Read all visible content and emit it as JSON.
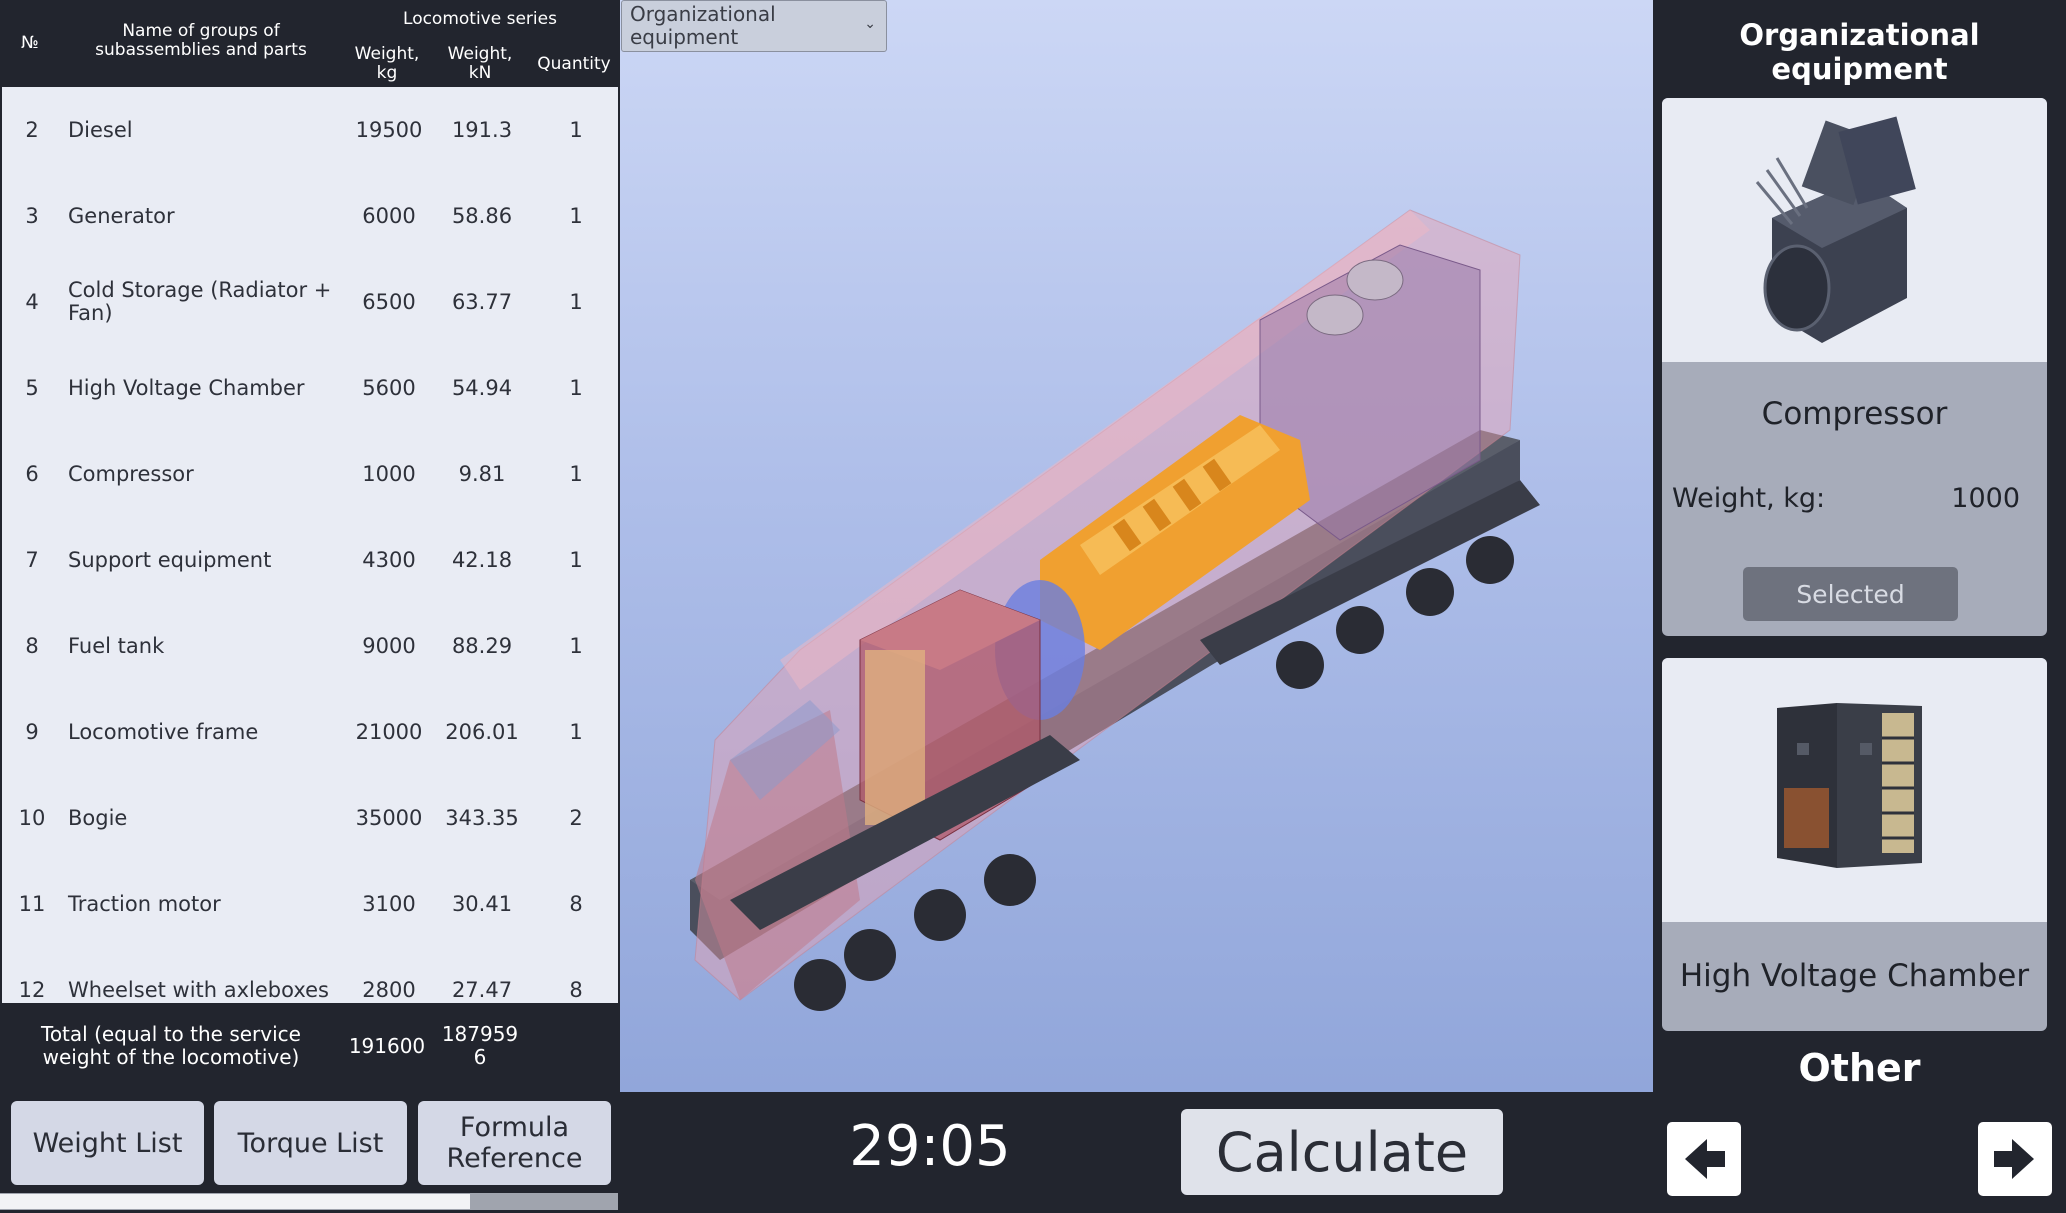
{
  "table": {
    "header": {
      "num": "№",
      "name": "Name of groups of subassemblies and parts",
      "series": "Locomotive series",
      "weight_kg": "Weight, kg",
      "weight_kn": "Weight, kN",
      "quantity": "Quantity"
    },
    "rows": [
      {
        "num": "2",
        "name": "Diesel",
        "kg": "19500",
        "kn": "191.3",
        "qty": "1"
      },
      {
        "num": "3",
        "name": "Generator",
        "kg": "6000",
        "kn": "58.86",
        "qty": "1"
      },
      {
        "num": "4",
        "name": "Cold Storage (Radiator + Fan)",
        "kg": "6500",
        "kn": "63.77",
        "qty": "1"
      },
      {
        "num": "5",
        "name": "High Voltage Chamber",
        "kg": "5600",
        "kn": "54.94",
        "qty": "1"
      },
      {
        "num": "6",
        "name": "Compressor",
        "kg": "1000",
        "kn": "9.81",
        "qty": "1"
      },
      {
        "num": "7",
        "name": "Support equipment",
        "kg": "4300",
        "kn": "42.18",
        "qty": "1"
      },
      {
        "num": "8",
        "name": "Fuel tank",
        "kg": "9000",
        "kn": "88.29",
        "qty": "1"
      },
      {
        "num": "9",
        "name": "Locomotive frame",
        "kg": "21000",
        "kn": "206.01",
        "qty": "1"
      },
      {
        "num": "10",
        "name": "Bogie",
        "kg": "35000",
        "kn": "343.35",
        "qty": "2"
      },
      {
        "num": "11",
        "name": "Traction motor",
        "kg": "3100",
        "kn": "30.41",
        "qty": "8"
      },
      {
        "num": "12",
        "name": "Wheelset with axleboxes",
        "kg": "2800",
        "kn": "27.47",
        "qty": "8"
      }
    ],
    "total": {
      "label": "Total (equal to the service weight of the locomotive)",
      "kg": "191600",
      "kn": "1879596"
    }
  },
  "buttons": {
    "weight_list": "Weight List",
    "torque_list": "Torque List",
    "formula_reference": "Formula Reference",
    "calculate": "Calculate"
  },
  "scroll": {
    "position_fraction": 0.76
  },
  "viewport": {
    "category_select": {
      "value": "Organizational equipment"
    }
  },
  "timer": "29:05",
  "right_panel": {
    "title": "Organizational equipment",
    "cards": [
      {
        "name": "Compressor",
        "weight_label": "Weight, kg:",
        "weight_value": "1000",
        "status": "Selected",
        "icon": "compressor-icon"
      },
      {
        "name": "High Voltage Chamber",
        "icon": "high-voltage-chamber-icon"
      }
    ],
    "next_category": "Other",
    "prev_icon": "arrow-left-icon",
    "next_icon": "arrow-right-icon"
  },
  "colors": {
    "background": "#22252e",
    "table_body": "#e9ecf4",
    "viewport_top": "#ccd7f5",
    "viewport_bottom": "#91a6da",
    "engine": "#f0a030",
    "body_shell": "#e8a0b0"
  }
}
